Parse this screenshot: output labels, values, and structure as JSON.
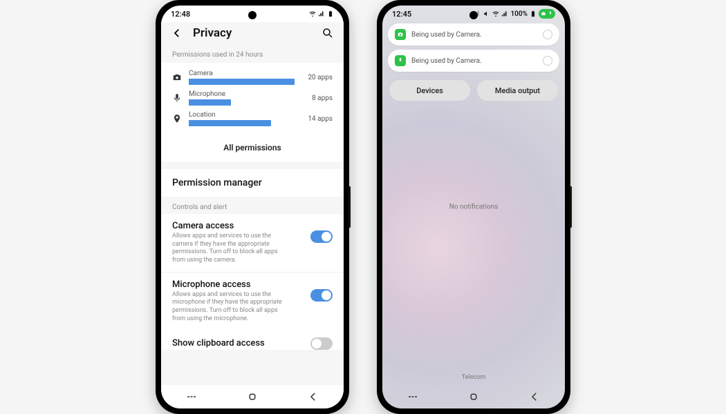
{
  "phone1": {
    "status": {
      "time": "12:48"
    },
    "header": {
      "title": "Privacy"
    },
    "usage_section_label": "Permissions used in 24 hours",
    "usage": [
      {
        "name": "Camera",
        "count": "20 apps",
        "pct": 100
      },
      {
        "name": "Microphone",
        "count": "8 apps",
        "pct": 40
      },
      {
        "name": "Location",
        "count": "14 apps",
        "pct": 78
      }
    ],
    "all_permissions": "All permissions",
    "permission_manager": "Permission manager",
    "controls_label": "Controls and alert",
    "camera_access": {
      "title": "Camera access",
      "desc": "Allows apps and services to use the camera if they have the appropriate permissions. Turn off to block all apps from using the camera."
    },
    "mic_access": {
      "title": "Microphone access",
      "desc": "Allows apps and services to use the microphone if they have the appropriate permissions. Turn off to block all apps from using the microphone."
    },
    "clipboard_access": {
      "title": "Show clipboard access"
    }
  },
  "phone2": {
    "status": {
      "time": "12:45",
      "battery": "100%"
    },
    "notifs": [
      {
        "icon": "camera",
        "text": "Being used by Camera."
      },
      {
        "icon": "mic",
        "text": "Being used by Camera."
      }
    ],
    "qs": {
      "devices": "Devices",
      "media": "Media output"
    },
    "no_notifications": "No notifications",
    "carrier": "Telecom"
  }
}
